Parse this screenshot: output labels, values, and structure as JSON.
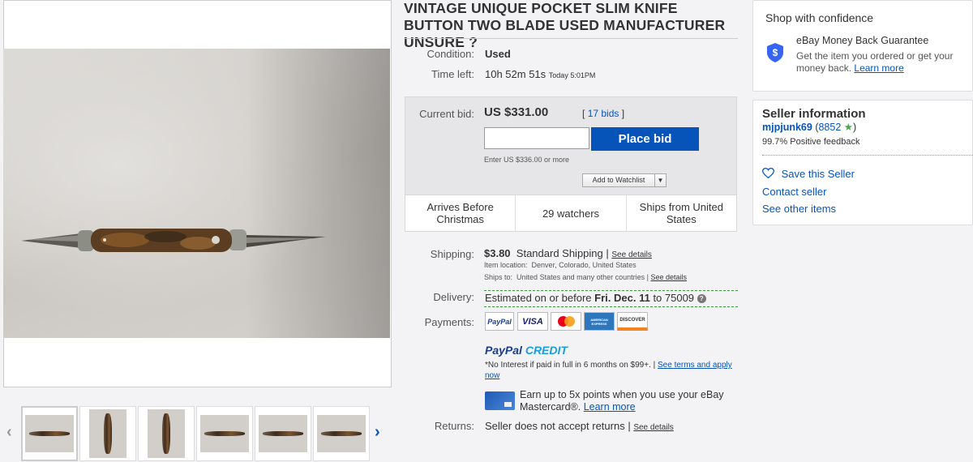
{
  "listing": {
    "title": "VINTAGE UNIQUE POCKET SLIM KNIFE BUTTON TWO BLADE USED MANUFACTURER UNSURE ?",
    "condition_label": "Condition:",
    "condition_value": "Used",
    "time_left_label": "Time left:",
    "time_left_value": "10h 52m 51s",
    "time_left_end": "Today 5:01PM"
  },
  "bid": {
    "current_bid_label": "Current bid:",
    "current_bid_value": "US $331.00",
    "bids_count": "17 bids",
    "bids_open": "[",
    "bids_close": "]",
    "input_value": "",
    "place_bid_label": "Place bid",
    "enter_hint": "Enter US $336.00 or more",
    "watchlist_label": "Add to Watchlist",
    "features": [
      "Arrives Before Christmas",
      "29 watchers",
      "Ships from United States"
    ]
  },
  "shipping": {
    "label": "Shipping:",
    "cost": "$3.80",
    "method": "Standard Shipping |",
    "see_details": "See details",
    "location_label": "Item location:",
    "location_value": "Denver, Colorado, United States",
    "ships_to_label": "Ships to:",
    "ships_to_value": "United States and many other countries |",
    "ships_to_details": "See details"
  },
  "delivery": {
    "label": "Delivery:",
    "prefix": "Estimated on or before",
    "date": "Fri. Dec. 11",
    "suffix": "to 75009",
    "help_icon": "?"
  },
  "payments": {
    "label": "Payments:",
    "methods": [
      "PayPal",
      "VISA",
      "mastercard",
      "AMERICAN EXPRESS",
      "DISCOVER"
    ]
  },
  "paypal_credit": {
    "logo_pay": "PayPal",
    "logo_credit": "CREDIT",
    "note": "*No Interest if paid in full in 6 months on $99+.  |",
    "terms_link": "See terms and apply now"
  },
  "mastercard_promo": {
    "text": "Earn up to 5x points when you use your eBay Mastercard®.",
    "link": "Learn more"
  },
  "returns": {
    "label": "Returns:",
    "value": "Seller does not accept returns |",
    "see_details": "See details"
  },
  "confidence": {
    "heading": "Shop with confidence",
    "guarantee_title": "eBay Money Back Guarantee",
    "guarantee_text": "Get the item you ordered or get your money back.",
    "learn_more": "Learn more"
  },
  "seller": {
    "heading": "Seller information",
    "username": "mjpjunk69",
    "feedback_open": "(",
    "feedback_score": "8852",
    "feedback_close": ")",
    "positive_feedback": "99.7% Positive feedback",
    "save_seller": "Save this Seller",
    "contact_seller": "Contact seller",
    "other_items": "See other items"
  },
  "gallery": {
    "prev_arrow": "‹",
    "next_arrow": "›",
    "thumb_count": 6
  },
  "colors": {
    "accent_blue": "#0654ba",
    "star_green": "#4aa74a",
    "bidbox_gray": "#e6e6e9"
  }
}
